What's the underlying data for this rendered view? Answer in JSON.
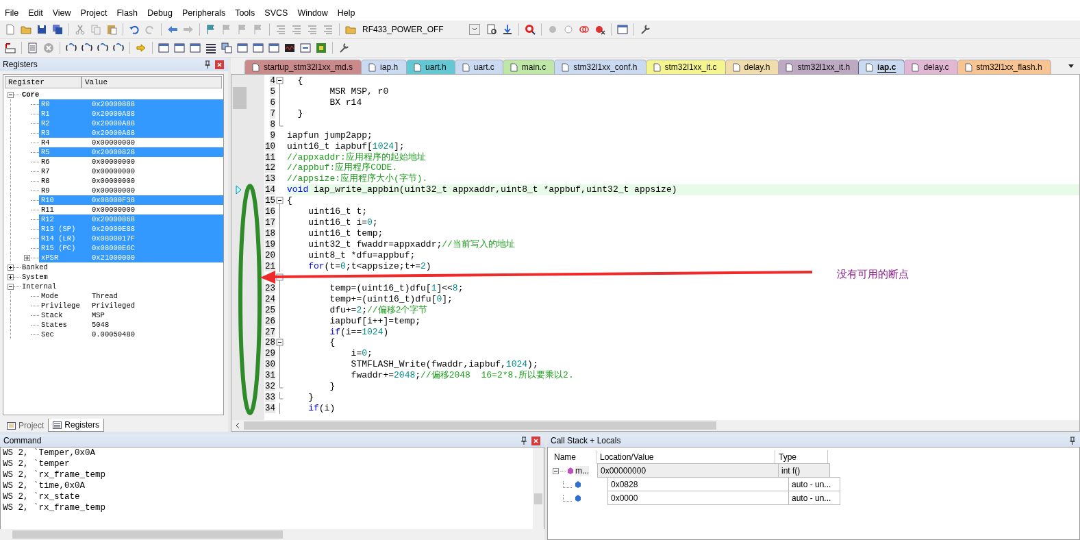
{
  "menu": [
    "File",
    "Edit",
    "View",
    "Project",
    "Flash",
    "Debug",
    "Peripherals",
    "Tools",
    "SVCS",
    "Window",
    "Help"
  ],
  "toolbar": {
    "target": "RF433_POWER_OFF"
  },
  "registers_panel": {
    "title": "Registers",
    "columns": [
      "Register",
      "Value"
    ],
    "groups": [
      {
        "name": "Core",
        "bold": true,
        "expanded": true,
        "items": [
          {
            "name": "R0",
            "value": "0x20000888",
            "selected": true
          },
          {
            "name": "R1",
            "value": "0x20000A88",
            "selected": true
          },
          {
            "name": "R2",
            "value": "0x20000A88",
            "selected": true
          },
          {
            "name": "R3",
            "value": "0x20000A88",
            "selected": true
          },
          {
            "name": "R4",
            "value": "0x00000000",
            "selected": false
          },
          {
            "name": "R5",
            "value": "0x20000828",
            "selected": true
          },
          {
            "name": "R6",
            "value": "0x00000000",
            "selected": false
          },
          {
            "name": "R7",
            "value": "0x00000000",
            "selected": false
          },
          {
            "name": "R8",
            "value": "0x00000000",
            "selected": false
          },
          {
            "name": "R9",
            "value": "0x00000000",
            "selected": false
          },
          {
            "name": "R10",
            "value": "0x08000F38",
            "selected": true
          },
          {
            "name": "R11",
            "value": "0x00000000",
            "selected": false
          },
          {
            "name": "R12",
            "value": "0x20000868",
            "selected": true
          },
          {
            "name": "R13 (SP)",
            "value": "0x20000E88",
            "selected": true
          },
          {
            "name": "R14 (LR)",
            "value": "0x0800017F",
            "selected": true
          },
          {
            "name": "R15 (PC)",
            "value": "0x08000E6C",
            "selected": true
          },
          {
            "name": "xPSR",
            "value": "0x21000000",
            "selected": true,
            "expanded": false
          }
        ]
      },
      {
        "name": "Banked",
        "bold": false,
        "expanded": false
      },
      {
        "name": "System",
        "bold": false,
        "expanded": false
      },
      {
        "name": "Internal",
        "bold": false,
        "expanded": true,
        "items": [
          {
            "name": "Mode",
            "value": "Thread",
            "selected": false
          },
          {
            "name": "Privilege",
            "value": "Privileged",
            "selected": false
          },
          {
            "name": "Stack",
            "value": "MSP",
            "selected": false
          },
          {
            "name": "States",
            "value": "5048",
            "selected": false
          },
          {
            "name": "Sec",
            "value": "0.00050480",
            "selected": false
          }
        ]
      }
    ],
    "tabs": [
      {
        "label": "Project",
        "selected": false
      },
      {
        "label": "Registers",
        "selected": true
      }
    ]
  },
  "editor": {
    "tabs": [
      {
        "label": "startup_stm32l1xx_md.s",
        "color": "#c98585",
        "selected": false
      },
      {
        "label": "iap.h",
        "color": "#c9d9f2",
        "selected": false
      },
      {
        "label": "uart.h",
        "color": "#5cc6d0",
        "selected": false
      },
      {
        "label": "uart.c",
        "color": "#c9d9f2",
        "selected": false
      },
      {
        "label": "main.c",
        "color": "#bde8a4",
        "selected": false
      },
      {
        "label": "stm32l1xx_conf.h",
        "color": "#c9d9f2",
        "selected": false
      },
      {
        "label": "stm32l1xx_it.c",
        "color": "#f6f68a",
        "selected": false
      },
      {
        "label": "delay.h",
        "color": "#f0dca8",
        "selected": false
      },
      {
        "label": "stm32l1xx_it.h",
        "color": "#bca6c0",
        "selected": false
      },
      {
        "label": "iap.c",
        "color": "#c9d9f2",
        "selected": true
      },
      {
        "label": "delay.c",
        "color": "#e2b4d2",
        "selected": false
      },
      {
        "label": "stm32l1xx_flash.h",
        "color": "#f8c28e",
        "selected": false
      }
    ],
    "lines": [
      {
        "number": "4",
        "kind": "fold_start",
        "current": false,
        "code": [
          {
            "kind": "plain",
            "text": "  {"
          }
        ]
      },
      {
        "number": "5",
        "kind": "fold_mid",
        "current": false,
        "code": [
          {
            "kind": "plain",
            "text": "        MSR MSP, r0"
          }
        ]
      },
      {
        "number": "6",
        "kind": "fold_mid",
        "current": false,
        "code": [
          {
            "kind": "plain",
            "text": "        BX r14"
          }
        ]
      },
      {
        "number": "7",
        "kind": "fold_mid",
        "current": false,
        "code": [
          {
            "kind": "plain",
            "text": "  }"
          }
        ]
      },
      {
        "number": "8",
        "kind": "fold_end",
        "current": false
      },
      {
        "number": "9",
        "kind": "plain",
        "current": false,
        "code": [
          {
            "kind": "plain",
            "text": "iapfun jump2app;"
          }
        ]
      },
      {
        "number": "10",
        "kind": "plain",
        "current": false,
        "code": [
          {
            "kind": "plain",
            "text": "uint16_t iapbuf["
          },
          {
            "kind": "number",
            "text": "1024"
          },
          {
            "kind": "plain",
            "text": "];"
          }
        ]
      },
      {
        "number": "11",
        "kind": "plain",
        "current": false,
        "code": [
          {
            "kind": "comment",
            "text": "//appxaddr:应用程序的起始地址"
          }
        ]
      },
      {
        "number": "12",
        "kind": "plain",
        "current": false,
        "code": [
          {
            "kind": "comment",
            "text": "//appbuf:应用程序CODE."
          }
        ]
      },
      {
        "number": "13",
        "kind": "plain",
        "current": false,
        "code": [
          {
            "kind": "comment",
            "text": "//appsize:应用程序大小(字节)."
          }
        ]
      },
      {
        "number": "14",
        "kind": "plain",
        "current": true,
        "code": [
          {
            "kind": "keyword",
            "text": "void"
          },
          {
            "kind": "plain",
            "text": " iap_write_appbin(uint32_t appxaddr,uint8_t *appbuf,uint32_t appsize)"
          }
        ]
      },
      {
        "number": "15",
        "kind": "fold_start",
        "current": false,
        "code": [
          {
            "kind": "plain",
            "text": "{"
          }
        ]
      },
      {
        "number": "16",
        "kind": "fold_mid",
        "current": false,
        "code": [
          {
            "kind": "plain",
            "text": "    uint16_t t;"
          }
        ]
      },
      {
        "number": "17",
        "kind": "fold_mid",
        "current": false,
        "code": [
          {
            "kind": "plain",
            "text": "    uint16_t i="
          },
          {
            "kind": "number",
            "text": "0"
          },
          {
            "kind": "plain",
            "text": ";"
          }
        ]
      },
      {
        "number": "18",
        "kind": "fold_mid",
        "current": false,
        "code": [
          {
            "kind": "plain",
            "text": "    uint16_t temp;"
          }
        ]
      },
      {
        "number": "19",
        "kind": "fold_mid",
        "current": false,
        "code": [
          {
            "kind": "plain",
            "text": "    uint32_t fwaddr=appxaddr;"
          },
          {
            "kind": "comment",
            "text": "//当前写入的地址"
          }
        ]
      },
      {
        "number": "20",
        "kind": "fold_mid",
        "current": false,
        "code": [
          {
            "kind": "plain",
            "text": "    uint8_t *dfu=appbuf;"
          }
        ]
      },
      {
        "number": "21",
        "kind": "fold_mid",
        "current": false,
        "code": [
          {
            "kind": "keyword",
            "text": "    for"
          },
          {
            "kind": "plain",
            "text": "(t="
          },
          {
            "kind": "number",
            "text": "0"
          },
          {
            "kind": "plain",
            "text": ";t<appsize;t+="
          },
          {
            "kind": "number",
            "text": "2"
          },
          {
            "kind": "plain",
            "text": ")"
          }
        ]
      },
      {
        "kind": "fold_start",
        "current": false
      },
      {
        "number": "23",
        "kind": "fold_mid",
        "current": false,
        "code": [
          {
            "kind": "plain",
            "text": "        temp=(uint16_t)dfu["
          },
          {
            "kind": "number",
            "text": "1"
          },
          {
            "kind": "plain",
            "text": "]<<"
          },
          {
            "kind": "number",
            "text": "8"
          },
          {
            "kind": "plain",
            "text": ";"
          }
        ]
      },
      {
        "number": "24",
        "kind": "fold_mid",
        "current": false,
        "code": [
          {
            "kind": "plain",
            "text": "        temp+=(uint16_t)dfu["
          },
          {
            "kind": "number",
            "text": "0"
          },
          {
            "kind": "plain",
            "text": "];"
          }
        ]
      },
      {
        "number": "25",
        "kind": "fold_mid",
        "current": false,
        "code": [
          {
            "kind": "plain",
            "text": "        dfu+="
          },
          {
            "kind": "number",
            "text": "2"
          },
          {
            "kind": "plain",
            "text": ";"
          },
          {
            "kind": "comment",
            "text": "//偏移2个字节"
          }
        ]
      },
      {
        "number": "26",
        "kind": "fold_mid",
        "current": false,
        "code": [
          {
            "kind": "plain",
            "text": "        iapbuf[i++]=temp;"
          }
        ]
      },
      {
        "number": "27",
        "kind": "fold_mid",
        "current": false,
        "code": [
          {
            "kind": "keyword",
            "text": "        if"
          },
          {
            "kind": "plain",
            "text": "(i=="
          },
          {
            "kind": "number",
            "text": "1024"
          },
          {
            "kind": "plain",
            "text": ")"
          }
        ]
      },
      {
        "number": "28",
        "kind": "fold_start",
        "current": false,
        "code": [
          {
            "kind": "plain",
            "text": "        {"
          }
        ]
      },
      {
        "number": "29",
        "kind": "fold_mid",
        "current": false,
        "code": [
          {
            "kind": "plain",
            "text": "            i="
          },
          {
            "kind": "number",
            "text": "0"
          },
          {
            "kind": "plain",
            "text": ";"
          }
        ]
      },
      {
        "number": "30",
        "kind": "fold_mid",
        "current": false,
        "code": [
          {
            "kind": "plain",
            "text": "            STMFLASH_Write(fwaddr,iapbuf,"
          },
          {
            "kind": "number",
            "text": "1024"
          },
          {
            "kind": "plain",
            "text": ");"
          }
        ]
      },
      {
        "number": "31",
        "kind": "fold_mid",
        "current": false,
        "code": [
          {
            "kind": "plain",
            "text": "            fwaddr+="
          },
          {
            "kind": "number",
            "text": "2048"
          },
          {
            "kind": "plain",
            "text": ";"
          },
          {
            "kind": "comment",
            "text": "//偏移2048  16=2*8.所以要乘以2."
          }
        ]
      },
      {
        "number": "32",
        "kind": "fold_end",
        "current": false,
        "code": [
          {
            "kind": "plain",
            "text": "        }"
          }
        ]
      },
      {
        "number": "33",
        "kind": "fold_end",
        "current": false,
        "code": [
          {
            "kind": "plain",
            "text": "    }"
          }
        ]
      },
      {
        "number": "34",
        "kind": "fold_mid",
        "current": false,
        "code": [
          {
            "kind": "keyword",
            "text": "    if"
          },
          {
            "kind": "plain",
            "text": "(i)"
          }
        ]
      }
    ],
    "annotation": {
      "text": "没有可用的断点"
    }
  },
  "command": {
    "title": "Command",
    "lines": [
      "WS 2, `Temper,0x0A",
      "WS 2, `temper",
      "WS 2, `rx_frame_temp",
      "WS 2, `time,0x0A",
      "WS 2, `rx_state",
      "WS 2, `rx_frame_temp"
    ]
  },
  "call_stack": {
    "title": "Call Stack + Locals",
    "columns": [
      "Name",
      "Location/Value",
      "Type"
    ],
    "rows": [
      {
        "name": "m...",
        "value": "0x00000000",
        "type": "int f()",
        "selected": true,
        "expanded": true,
        "children": [
          {
            "value": "0x0828",
            "type": "auto - un...",
            "selected": false
          },
          {
            "value": "0x0000",
            "type": "auto - un...",
            "selected": false
          }
        ]
      }
    ]
  }
}
